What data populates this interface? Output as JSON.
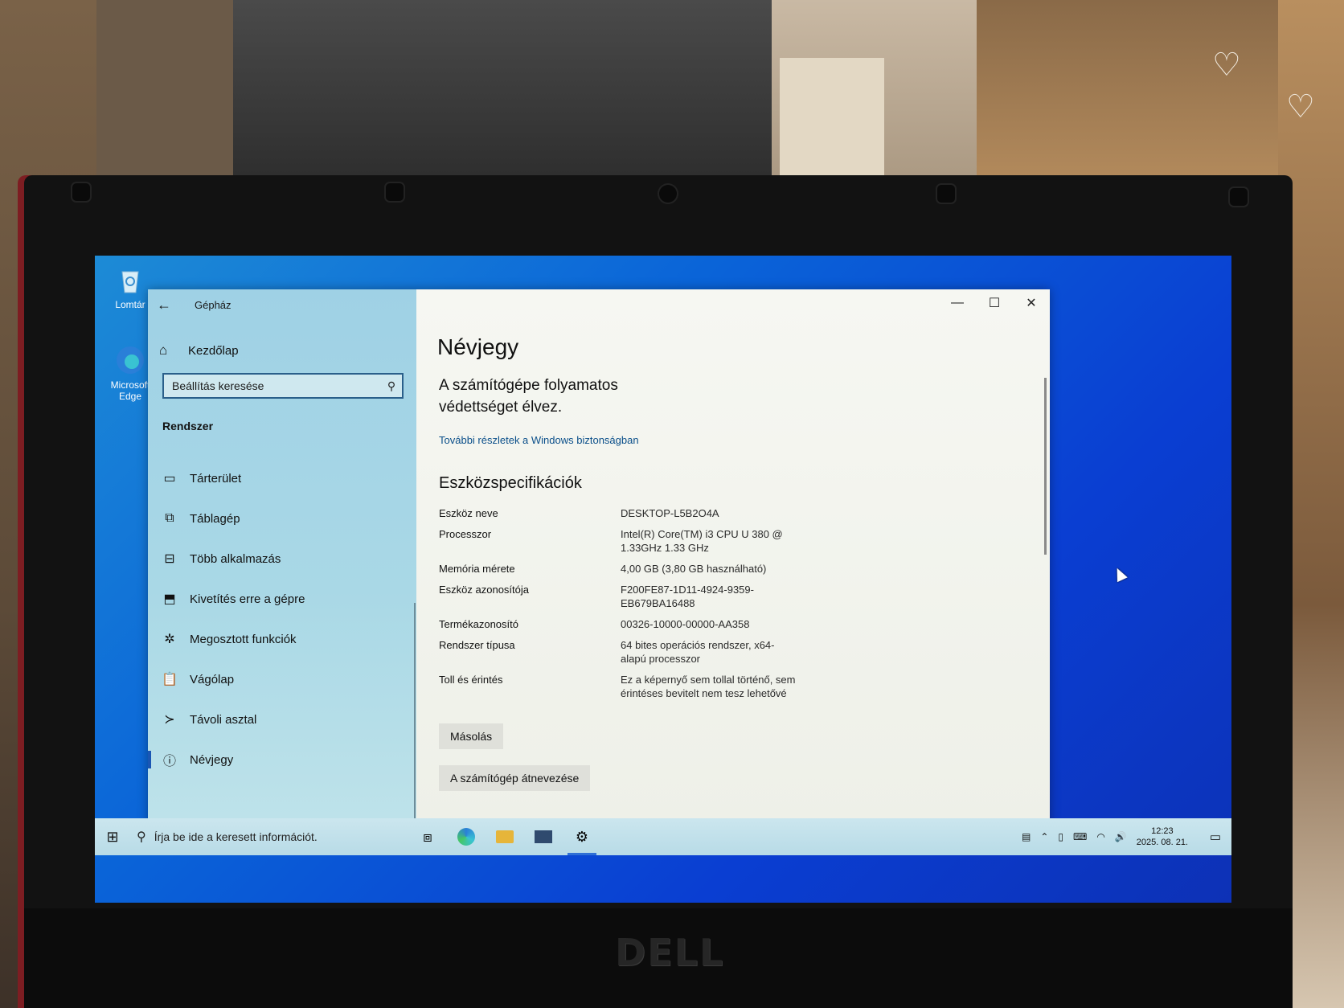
{
  "desktop": {
    "icons": [
      {
        "label": "Lomtár",
        "icon": "recycle-bin-icon"
      },
      {
        "label": "Microsoft Edge",
        "icon": "edge-icon"
      }
    ]
  },
  "window": {
    "app_title": "Gépház",
    "controls": {
      "minimize": "—",
      "maximize": "☐",
      "close": "✕"
    }
  },
  "sidebar": {
    "home_label": "Kezdőlap",
    "search_placeholder": "Beállítás keresése",
    "section_title": "Rendszer",
    "items": [
      {
        "label": "Tárterület",
        "icon": "storage-icon",
        "glyph": "▭"
      },
      {
        "label": "Táblagép",
        "icon": "tablet-icon",
        "glyph": "⧉"
      },
      {
        "label": "Több alkalmazás",
        "icon": "multitasking-icon",
        "glyph": "⊟"
      },
      {
        "label": "Kivetítés erre a gépre",
        "icon": "projecting-icon",
        "glyph": "⬒"
      },
      {
        "label": "Megosztott funkciók",
        "icon": "shared-experiences-icon",
        "glyph": "✲"
      },
      {
        "label": "Vágólap",
        "icon": "clipboard-icon",
        "glyph": "📋"
      },
      {
        "label": "Távoli asztal",
        "icon": "remote-desktop-icon",
        "glyph": "≻"
      },
      {
        "label": "Névjegy",
        "icon": "info-icon",
        "glyph": "ⓘ",
        "active": true
      }
    ]
  },
  "content": {
    "title": "Névjegy",
    "protection_text": "A számítógépe folyamatos védettséget élvez.",
    "security_link": "További részletek a Windows biztonságban",
    "specs_title": "Eszközspecifikációk",
    "specs": [
      {
        "key": "Eszköz neve",
        "value": "DESKTOP-L5B2O4A"
      },
      {
        "key": "Processzor",
        "value": "Intel(R) Core(TM) i3 CPU       U 380 @ 1.33GHz   1.33 GHz"
      },
      {
        "key": "Memória mérete",
        "value": "4,00 GB (3,80 GB használható)"
      },
      {
        "key": "Eszköz azonosítója",
        "value": "F200FE87-1D11-4924-9359-EB679BA16488"
      },
      {
        "key": "Termékazonosító",
        "value": "00326-10000-00000-AA358"
      },
      {
        "key": "Rendszer típusa",
        "value": "64 bites operációs rendszer, x64-alapú processzor"
      },
      {
        "key": "Toll és érintés",
        "value": "Ez a képernyő sem tollal történő, sem érintéses bevitelt nem tesz lehetővé"
      }
    ],
    "copy_button": "Másolás",
    "rename_button": "A számítógép átnevezése"
  },
  "taskbar": {
    "search_placeholder": "Írja be ide a keresett információt.",
    "time": "12:23",
    "date": "2025. 08. 21."
  },
  "laptop": {
    "brand": "DELL"
  }
}
